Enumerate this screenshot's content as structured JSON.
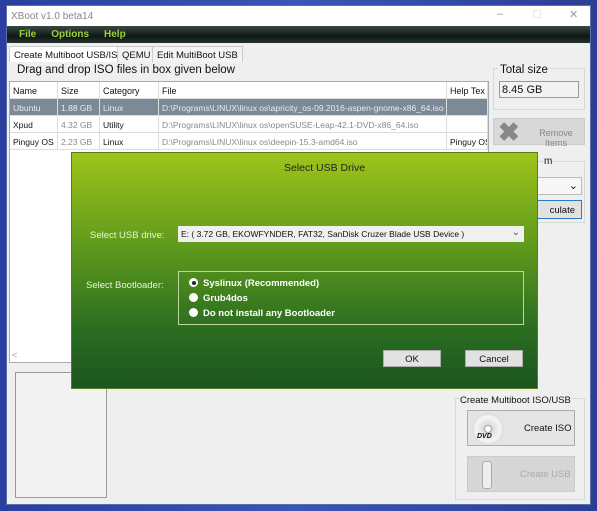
{
  "window": {
    "title": "XBoot v1.0 beta14",
    "controls": {
      "minimize": "–",
      "maximize": "☐",
      "close": "✕"
    }
  },
  "menu": [
    "File",
    "Options",
    "Help"
  ],
  "tabs": [
    {
      "label": "Create Multiboot USB/ISO",
      "active": true
    },
    {
      "label": "QEMU"
    },
    {
      "label": "Edit MultiBoot USB"
    }
  ],
  "drag_label": "Drag and drop ISO files in box given below",
  "table": {
    "headers": [
      "Name",
      "Size",
      "Category",
      "File",
      "Help Tex"
    ],
    "rows": [
      {
        "name": "Ubuntu",
        "size": "1.88 GB",
        "category": "Linux",
        "file": "D:\\Programs\\LINUX\\linux os\\apricity_os-09.2016-aspen-gnome-x86_64.iso",
        "help": "",
        "selected": true
      },
      {
        "name": "Xpud",
        "size": "4.32 GB",
        "category": "Utility",
        "file": "D:\\Programs\\LINUX\\linux os\\openSUSE-Leap-42.1-DVD-x86_64.iso",
        "help": ""
      },
      {
        "name": "Pinguy OS",
        "size": "2.23 GB",
        "category": "Linux",
        "file": "D:\\Programs\\LINUX\\linux os\\deepin-15.3-amd64.iso",
        "help": "Pinguy OS"
      }
    ],
    "scroll_left": "<"
  },
  "total_size": {
    "label": "Total size",
    "value": "8.45 GB"
  },
  "remove_items": {
    "label": "Remove Items",
    "icon": "x-icon"
  },
  "partial_group": {
    "label_fragment": "m",
    "calculate_fragment": "culate",
    "combo_arrow": "⌄"
  },
  "create_group": {
    "label": "Create Multiboot ISO/USB",
    "create_iso": "Create ISO",
    "create_usb": "Create USB",
    "dvd_text": "DVD"
  },
  "dialog": {
    "title": "Select USB Drive",
    "usb_label": "Select USB drive:",
    "usb_value": "E:  ( 3.72 GB,   EKOWFYNDER,   FAT32,   SanDisk Cruzer Blade USB Device )",
    "bootloader_label": "Select Bootloader:",
    "bootloaders": [
      {
        "label": "Syslinux    (Recommended)",
        "checked": true
      },
      {
        "label": "Grub4dos"
      },
      {
        "label": "Do not install any Bootloader"
      }
    ],
    "ok": "OK",
    "cancel": "Cancel",
    "colors": {
      "top": "#9ec41a",
      "bottom": "#1c5520"
    }
  }
}
